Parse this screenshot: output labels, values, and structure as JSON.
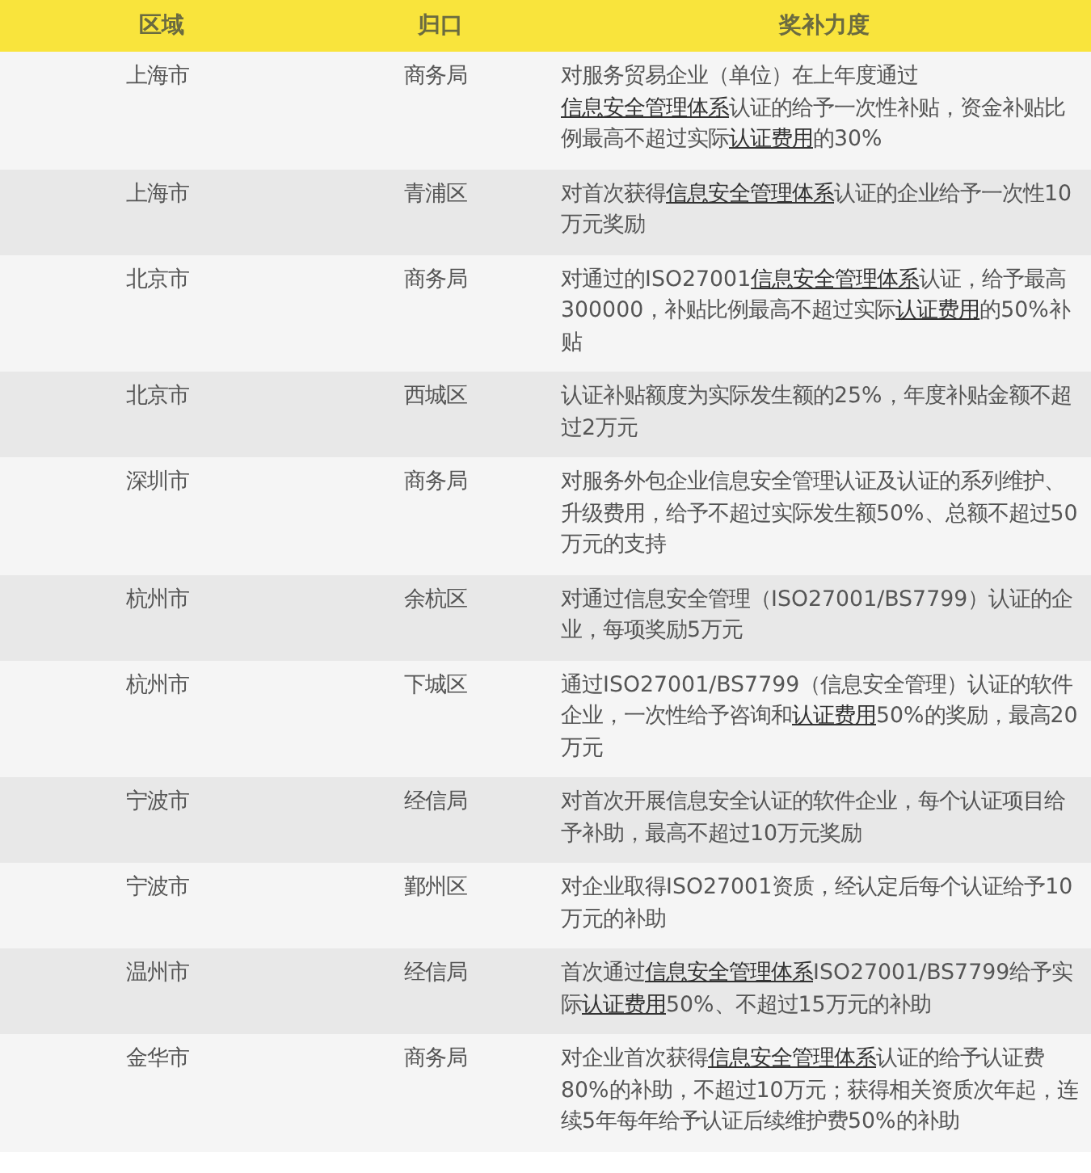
{
  "table": {
    "columns": [
      "区域",
      "归口",
      "奖补力度"
    ],
    "rows": [
      {
        "region": "上海市",
        "department": "商务局",
        "subsidy": [
          {
            "text": "对服务贸易企业（单位）在上年度通过",
            "link": false
          },
          {
            "text": "信息安全管理体系",
            "link": true
          },
          {
            "text": "认证的给予一次性补贴，资金补贴比例最高不超过实际",
            "link": false
          },
          {
            "text": "认证费用",
            "link": true
          },
          {
            "text": "的30%",
            "link": false
          }
        ]
      },
      {
        "region": "上海市",
        "department": "青浦区",
        "subsidy": [
          {
            "text": "对首次获得",
            "link": false
          },
          {
            "text": "信息安全管理体系",
            "link": true
          },
          {
            "text": "认证的企业给予一次性10万元奖励",
            "link": false
          }
        ]
      },
      {
        "region": "北京市",
        "department": "商务局",
        "subsidy": [
          {
            "text": "对通过的ISO27001",
            "link": false
          },
          {
            "text": "信息安全管理体系",
            "link": true
          },
          {
            "text": "认证，给予最高300000，补贴比例最高不超过实际",
            "link": false
          },
          {
            "text": "认证费用",
            "link": true
          },
          {
            "text": "的50%补贴",
            "link": false
          }
        ]
      },
      {
        "region": "北京市",
        "department": "西城区",
        "subsidy": [
          {
            "text": "认证补贴额度为实际发生额的25%，年度补贴金额不超过2万元",
            "link": false
          }
        ]
      },
      {
        "region": "深圳市",
        "department": "商务局",
        "subsidy": [
          {
            "text": "对服务外包企业信息安全管理认证及认证的系列维护、升级费用，给予不超过实际发生额50%、总额不超过50万元的支持",
            "link": false
          }
        ]
      },
      {
        "region": "杭州市",
        "department": "余杭区",
        "subsidy": [
          {
            "text": "对通过信息安全管理（ISO27001/BS7799）认证的企业，每项奖励5万元",
            "link": false
          }
        ]
      },
      {
        "region": "杭州市",
        "department": "下城区",
        "subsidy": [
          {
            "text": "通过ISO27001/BS7799（信息安全管理）认证的软件企业，一次性给予咨询和",
            "link": false
          },
          {
            "text": "认证费用",
            "link": true
          },
          {
            "text": "50%的奖励，最高20万元",
            "link": false
          }
        ]
      },
      {
        "region": "宁波市",
        "department": "经信局",
        "subsidy": [
          {
            "text": "对首次开展信息安全认证的软件企业，每个认证项目给予补助，最高不超过10万元奖励",
            "link": false
          }
        ]
      },
      {
        "region": "宁波市",
        "department": "鄞州区",
        "subsidy": [
          {
            "text": "对企业取得ISO27001资质，经认定后每个认证给予10万元的补助",
            "link": false
          }
        ]
      },
      {
        "region": "温州市",
        "department": "经信局",
        "subsidy": [
          {
            "text": "首次通过",
            "link": false
          },
          {
            "text": "信息安全管理体系",
            "link": true
          },
          {
            "text": "ISO27001/BS7799给予实际",
            "link": false
          },
          {
            "text": "认证费用",
            "link": true
          },
          {
            "text": "50%、不超过15万元的补助",
            "link": false
          }
        ]
      },
      {
        "region": "金华市",
        "department": "商务局",
        "subsidy": [
          {
            "text": "对企业首次获得",
            "link": false
          },
          {
            "text": "信息安全管理体系",
            "link": true
          },
          {
            "text": "认证的给予认证费80%的补助，不超过10万元；获得相关资质次年起，连续5年每年给予认证后续维护费50%的补助",
            "link": false
          }
        ]
      }
    ]
  }
}
